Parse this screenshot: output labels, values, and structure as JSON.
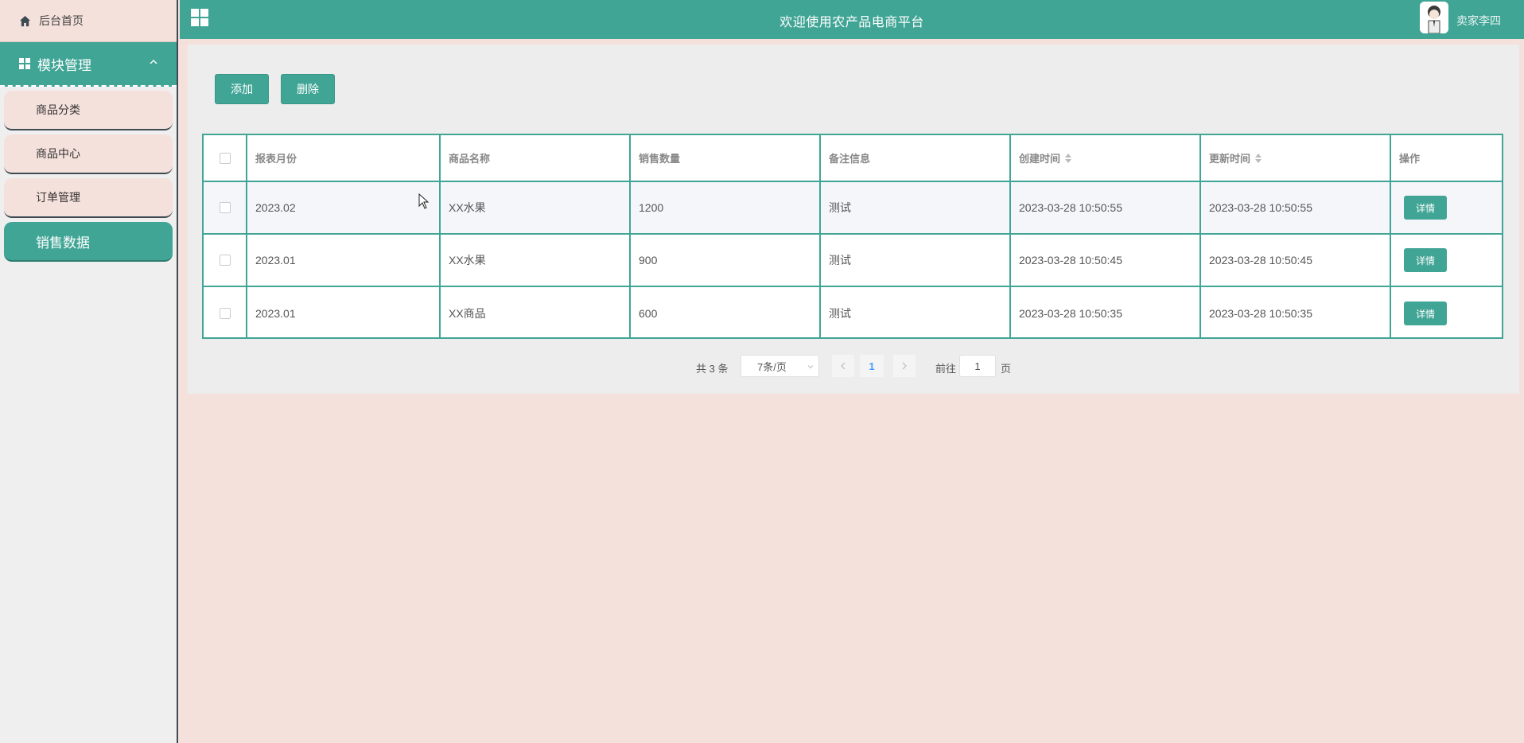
{
  "sidebar": {
    "home_label": "后台首页",
    "module_label": "模块管理",
    "items": [
      {
        "label": "商品分类"
      },
      {
        "label": "商品中心"
      },
      {
        "label": "订单管理"
      },
      {
        "label": "销售数据"
      }
    ]
  },
  "header": {
    "title": "欢迎使用农产品电商平台",
    "user": "卖家李四"
  },
  "toolbar": {
    "add_label": "添加",
    "delete_label": "删除"
  },
  "table": {
    "columns": [
      "报表月份",
      "商品名称",
      "销售数量",
      "备注信息",
      "创建时间",
      "更新时间",
      "操作"
    ],
    "rows": [
      {
        "month": "2023.02",
        "name": "XX水果",
        "qty": "1200",
        "note": "测试",
        "created": "2023-03-28 10:50:55",
        "updated": "2023-03-28 10:50:55",
        "action": "详情"
      },
      {
        "month": "2023.01",
        "name": "XX水果",
        "qty": "900",
        "note": "测试",
        "created": "2023-03-28 10:50:45",
        "updated": "2023-03-28 10:50:45",
        "action": "详情"
      },
      {
        "month": "2023.01",
        "name": "XX商品",
        "qty": "600",
        "note": "测试",
        "created": "2023-03-28 10:50:35",
        "updated": "2023-03-28 10:50:35",
        "action": "详情"
      }
    ]
  },
  "pagination": {
    "total": "共 3 条",
    "page_size": "7条/页",
    "current_page": "1",
    "goto_label": "前往",
    "goto_value": "1",
    "page_suffix": "页"
  },
  "colors": {
    "accent": "#41a596",
    "background": "#f5e1dc"
  }
}
